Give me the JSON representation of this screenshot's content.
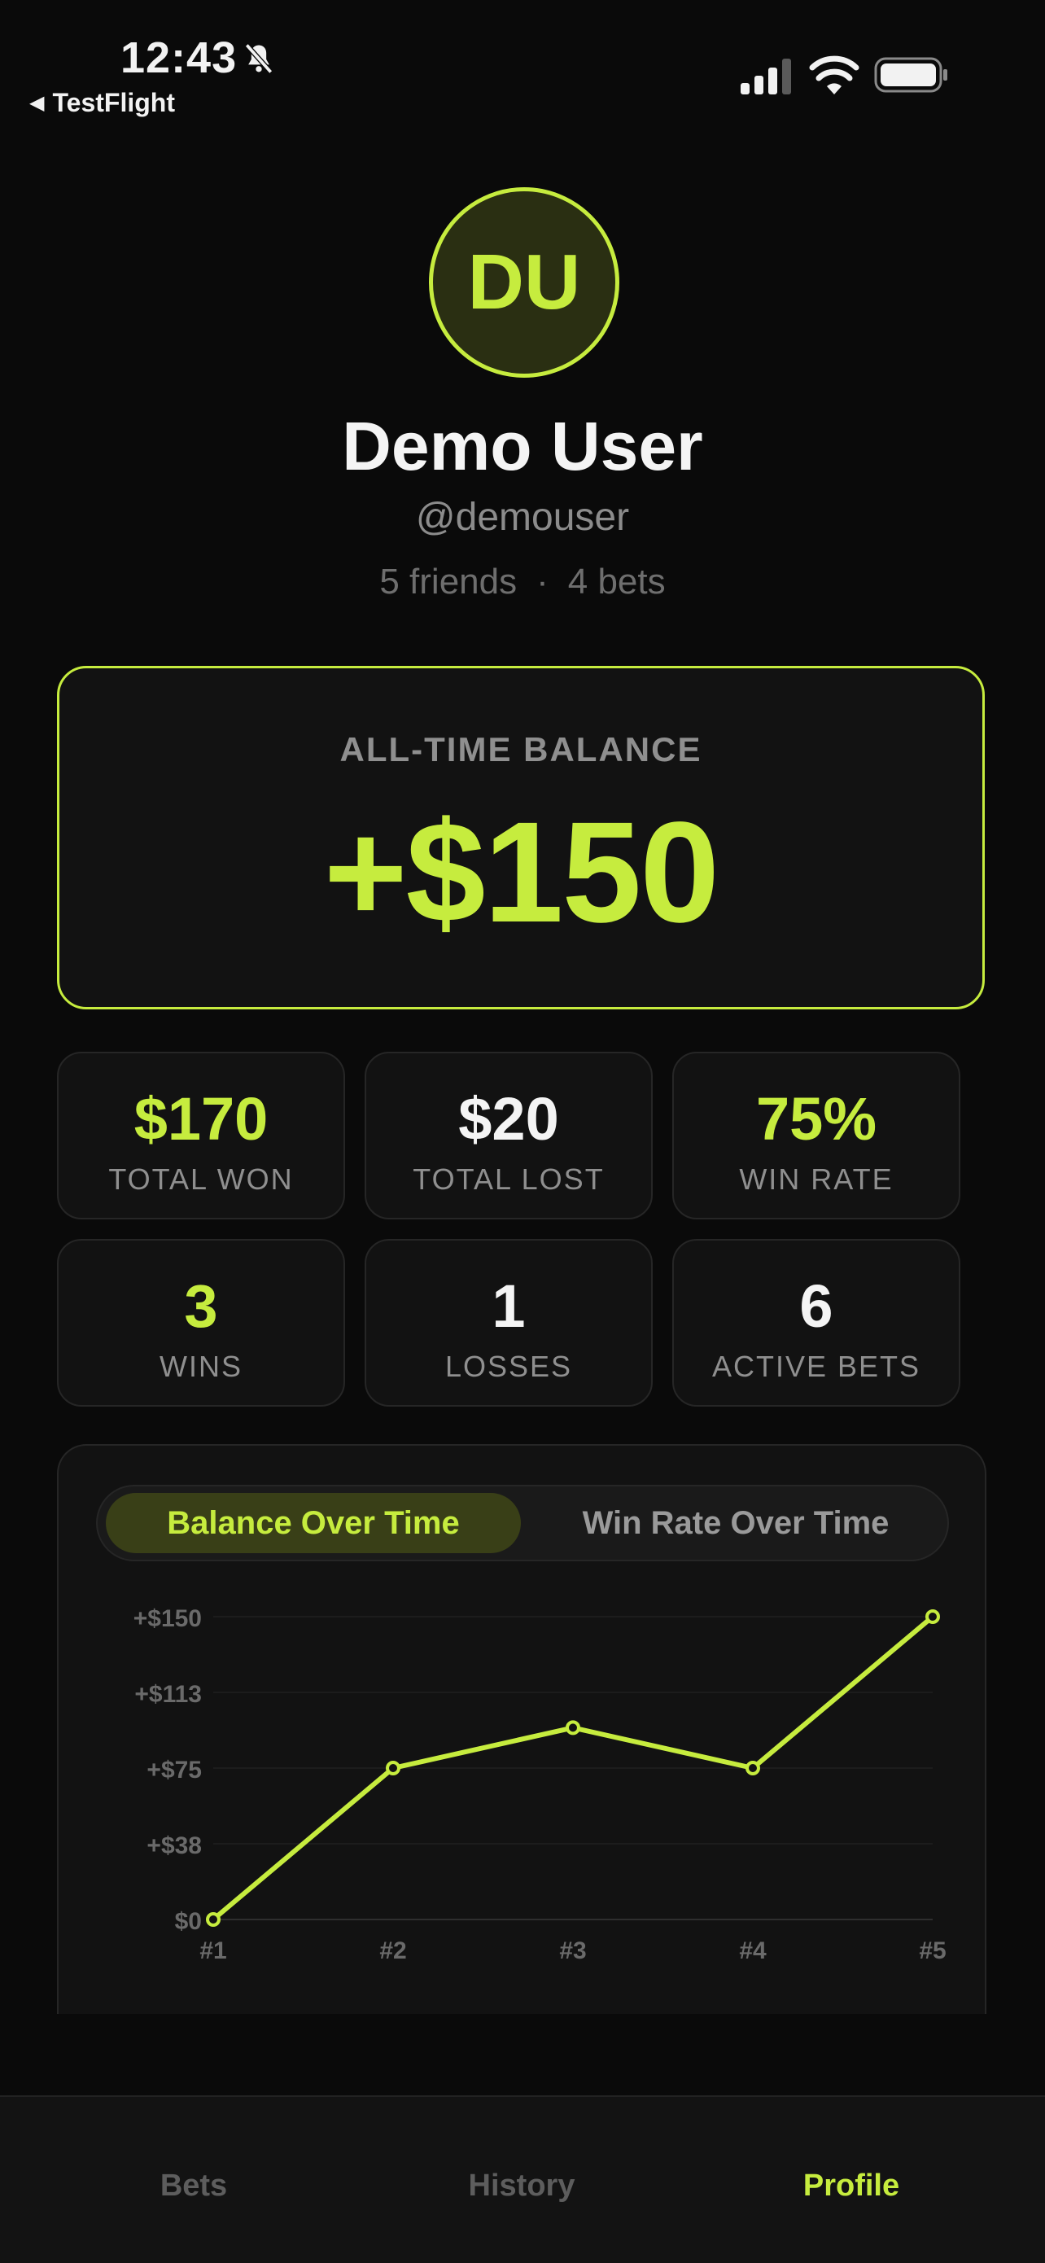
{
  "status_bar": {
    "time": "12:43",
    "back_label": "TestFlight",
    "icons": [
      "bell-slash-icon",
      "cellular-signal-icon",
      "wifi-icon",
      "battery-icon"
    ]
  },
  "profile": {
    "initials": "DU",
    "name": "Demo User",
    "handle": "@demouser",
    "friends": "5 friends",
    "separator": "·",
    "bets": "4 bets"
  },
  "balance": {
    "label": "ALL-TIME BALANCE",
    "value": "+$150"
  },
  "stats": [
    {
      "value": "$170",
      "label": "TOTAL WON"
    },
    {
      "value": "$20",
      "label": "TOTAL LOST"
    },
    {
      "value": "75%",
      "label": "WIN RATE"
    },
    {
      "value": "3",
      "label": "WINS"
    },
    {
      "value": "1",
      "label": "LOSSES"
    },
    {
      "value": "6",
      "label": "ACTIVE BETS"
    }
  ],
  "chart_tabs": {
    "active": "Balance Over Time",
    "inactive": "Win Rate Over Time"
  },
  "chart_data": {
    "type": "line",
    "x": [
      "#1",
      "#2",
      "#3",
      "#4",
      "#5"
    ],
    "series": [
      {
        "values": [
          0,
          75,
          95,
          75,
          150
        ]
      }
    ],
    "y_ticks": [
      "+$150",
      "+$113",
      "+$75",
      "+$38",
      "$0"
    ],
    "ylim": [
      0,
      150
    ],
    "grid": true,
    "line_color": "#c6ec3e"
  },
  "tabbar": {
    "tabs": [
      "Bets",
      "History",
      "Profile"
    ],
    "active": "Profile"
  },
  "colors": {
    "accent": "#c6ec3e",
    "background": "#0a0a0a",
    "card": "#121212"
  }
}
